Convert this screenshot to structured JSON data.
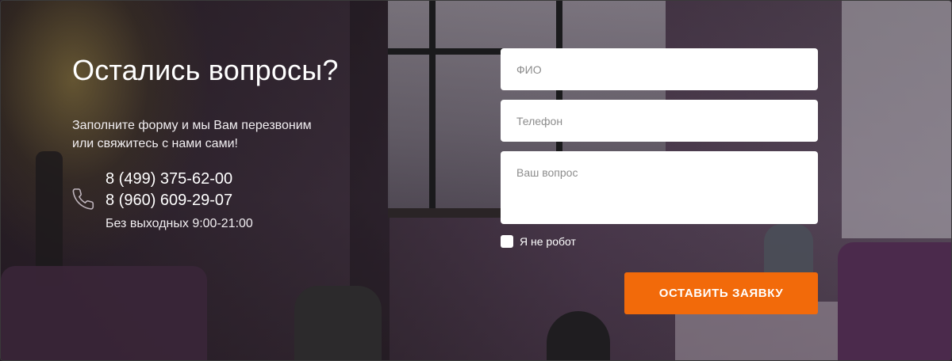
{
  "heading": {
    "title": "Остались вопросы?",
    "subtitle_line1": "Заполните форму и мы Вам перезвоним",
    "subtitle_line2": "или свяжитесь с нами сами!"
  },
  "contacts": {
    "icon": "phone-icon",
    "phone1": "8 (499) 375-62-00",
    "phone2": "8 (960) 609-29-07",
    "hours": "Без выходных 9:00-21:00"
  },
  "form": {
    "name_placeholder": "ФИО",
    "phone_placeholder": "Телефон",
    "question_placeholder": "Ваш вопрос",
    "captcha_label": "Я не робот",
    "captcha_checked": false,
    "submit_label": "ОСТАВИТЬ ЗАЯВКУ"
  },
  "colors": {
    "accent": "#f26a0a",
    "field_background": "#ffffff",
    "text": "#ffffff"
  }
}
